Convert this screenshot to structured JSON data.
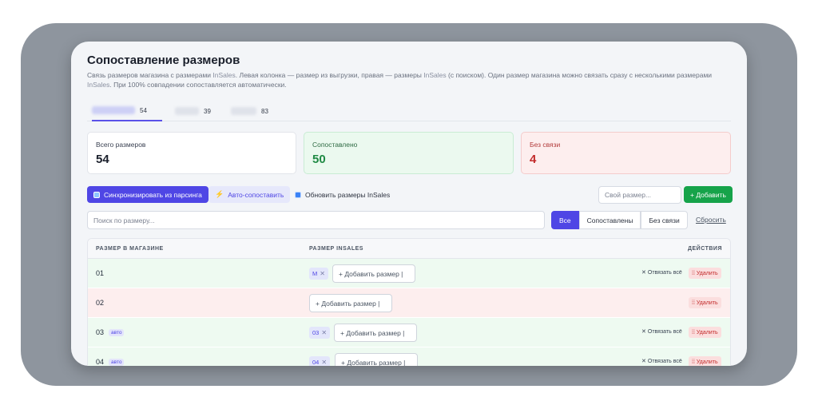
{
  "page": {
    "title": "Сопоставление размеров",
    "description_prefix": "Связь размеров магазина с размерами ",
    "brand": "InSales",
    "description_mid1": ". Левая колонка — размер из выгрузки, правая — размеры ",
    "description_mid2": " (с поиском). Один размер магазина можно связать сразу с несколькими размерами ",
    "description_suffix": ". При 100% совпадении сопоставляется автоматически."
  },
  "tabs": [
    {
      "count": "54"
    },
    {
      "count": "39"
    },
    {
      "count": "83"
    }
  ],
  "stats": {
    "total": {
      "label": "Всего размеров",
      "value": "54"
    },
    "matched": {
      "label": "Сопоставлено",
      "value": "50"
    },
    "unlinked": {
      "label": "Без связи",
      "value": "4"
    }
  },
  "toolbar": {
    "sync_label": "Синхронизировать из парсинга",
    "auto_label": "Авто-сопоставить",
    "refresh_label": "Обновить размеры InSales",
    "own_size_placeholder": "Свой размер...",
    "add_label": "+ Добавить"
  },
  "search": {
    "placeholder": "Поиск по размеру..."
  },
  "filters": {
    "all": "Все",
    "matched": "Сопоставлены",
    "unlinked": "Без связи",
    "reset": "Сбросить"
  },
  "table": {
    "headers": {
      "store_size": "РАЗМЕР В МАГАЗИНЕ",
      "insales_size": "РАЗМЕР INSALES",
      "actions": "ДЕЙСТВИЯ"
    },
    "add_size_label": "+ Добавить размер",
    "unlink_label": "Отвязать всё",
    "delete_label": "Удалить",
    "auto_badge": "авто",
    "rows": [
      {
        "size": "01",
        "chip": "M"
      },
      {
        "size": "02"
      },
      {
        "size": "03",
        "chip": "03"
      },
      {
        "size": "04",
        "chip": "04"
      }
    ]
  },
  "colors": {
    "accent": "#4f46e5",
    "success": "#16a34a",
    "danger": "#c22a2a"
  }
}
